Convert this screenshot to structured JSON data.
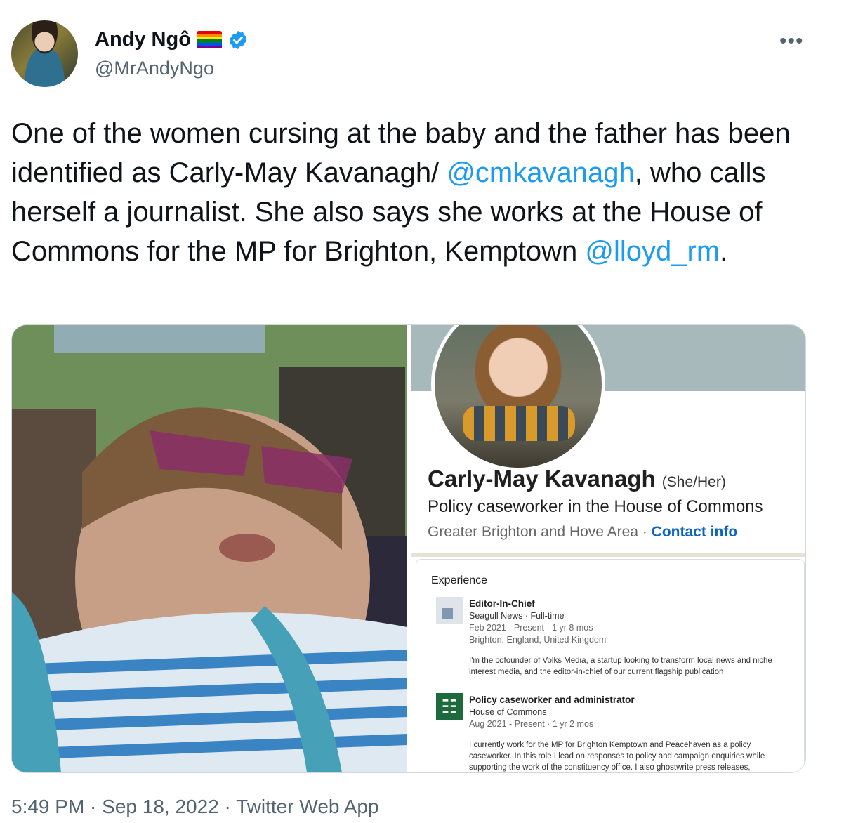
{
  "author": {
    "display_name": "Andy Ngô",
    "handle": "@MrAndyNgo",
    "badges": [
      "rainbow-flag-icon",
      "verified-badge-icon"
    ]
  },
  "more_label": "•••",
  "tweet": {
    "part1": "One of the women cursing at the baby and the father has been identified as Carly-May Kavanagh/ ",
    "mention1": "@cmkavanagh",
    "part2": ", who calls herself a journalist. She also says she works at the House of Commons for the MP for Brighton, Kemptown ",
    "mention2": "@lloyd_rm",
    "part3": "."
  },
  "media": {
    "profile": {
      "name": "Carly-May Kavanagh",
      "pronouns": "(She/Her)",
      "headline": "Policy caseworker in the House of Commons",
      "location": "Greater Brighton and Hove Area · ",
      "contact_label": "Contact info"
    },
    "experience": {
      "title": "Experience",
      "jobs": [
        {
          "role": "Editor-In-Chief",
          "company": "Seagull News · Full-time",
          "dates": "Feb 2021 - Present · 1 yr 8 mos",
          "place": "Brighton, England, United Kingdom",
          "desc": "I'm the cofounder of Volks Media, a startup looking to transform local news and niche interest media, and the editor-in-chief of our current flagship publication"
        },
        {
          "role": "Policy caseworker and administrator",
          "company": "House of Commons",
          "dates": "Aug 2021 - Present · 1 yr 2 mos",
          "desc": "I currently work for the MP for Brighton Kemptown and Peacehaven as a policy caseworker. In this role I lead on responses to policy and campaign enquiries while supporting the work of the constituency office. I also ghostwrite press releases,"
        }
      ]
    }
  },
  "footer": {
    "time": "5:49 PM",
    "date": "Sep 18, 2022",
    "source": "Twitter Web App",
    "separator": " · "
  },
  "colors": {
    "link": "#1d9bf0",
    "secondary_text": "#536471",
    "linkedin_blue": "#0a66c2"
  }
}
